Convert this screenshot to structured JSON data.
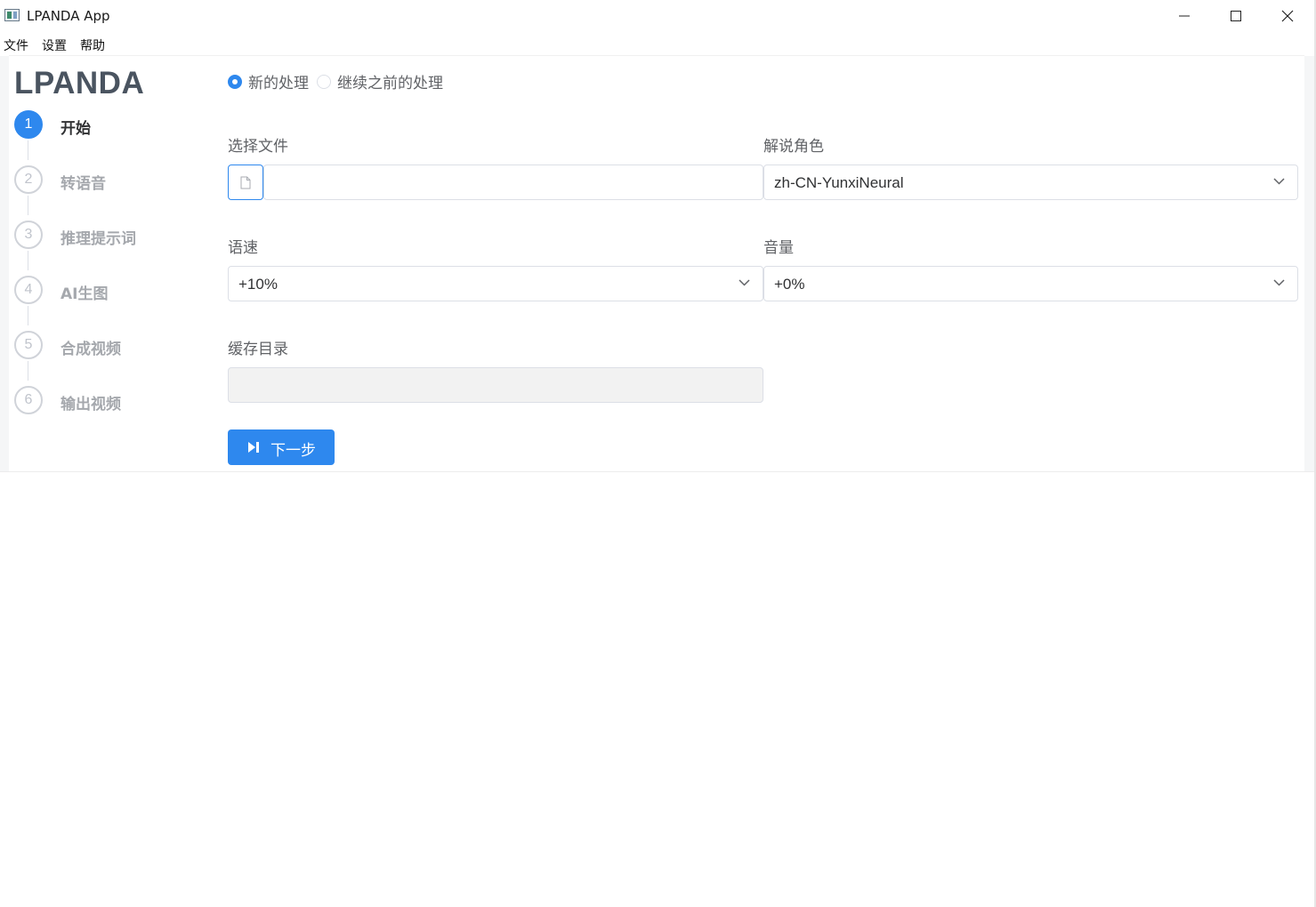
{
  "window": {
    "title": "LPANDA App"
  },
  "menu": [
    "文件",
    "设置",
    "帮助"
  ],
  "logo": "LPANDA",
  "steps": [
    {
      "num": "1",
      "label": "开始",
      "active": true
    },
    {
      "num": "2",
      "label": "转语音",
      "active": false
    },
    {
      "num": "3",
      "label": "推理提示词",
      "active": false
    },
    {
      "num": "4",
      "label": "AI生图",
      "active": false
    },
    {
      "num": "5",
      "label": "合成视频",
      "active": false
    },
    {
      "num": "6",
      "label": "输出视频",
      "active": false
    }
  ],
  "mode": {
    "options": [
      "新的处理",
      "继续之前的处理"
    ],
    "selected": "新的处理"
  },
  "form": {
    "file_label": "选择文件",
    "file_value": "",
    "narrator_label": "解说角色",
    "narrator_value": "zh-CN-YunxiNeural",
    "speed_label": "语速",
    "speed_value": "+10%",
    "volume_label": "音量",
    "volume_value": "+0%",
    "cache_label": "缓存目录",
    "cache_value": ""
  },
  "next_button": "下一步",
  "colors": {
    "accent": "#2e88ee",
    "border": "#dcdfe6",
    "muted_text": "#a5a8ad"
  }
}
